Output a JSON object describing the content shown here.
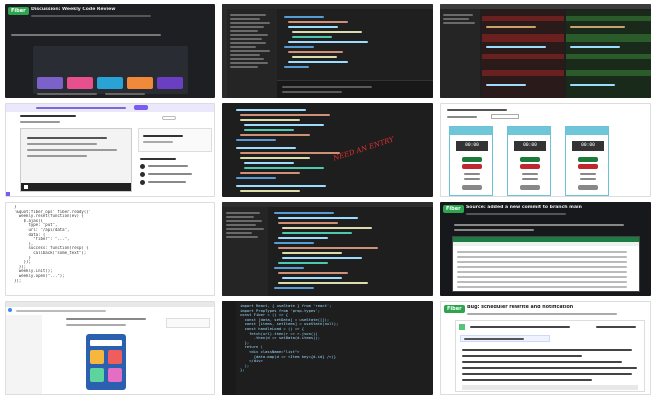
{
  "tiles": {
    "t1": {
      "badge": "Fiber",
      "title": "Discussion: Weekly Code Review",
      "cards": [
        "",
        "",
        "",
        "",
        ""
      ]
    },
    "t5": {
      "banner": "",
      "banner_button": "",
      "page_title": "",
      "sidebar_title": "",
      "sidebar_subtitle": "",
      "list_title": "",
      "follow_label": ""
    },
    "t6": {
      "handwritten": "NEED AN ENTRY"
    },
    "t7": {
      "title": "",
      "filter_label": "",
      "panels": [
        {
          "header": "",
          "value": "00:00"
        },
        {
          "header": "",
          "value": "00:00"
        },
        {
          "header": "",
          "value": "00:00"
        }
      ],
      "start": "",
      "stop": "",
      "reset": ""
    },
    "t8": {
      "code": [
        "}",
        "'&quot;fiber_ops' fiber.ready()'",
        "",
        "",
        "  weekly.reset(function(ev) {",
        "    $.ajax({",
        "      type: \"put\",",
        "      url: \"/api/data\",",
        "      data: {",
        "        \"fiber\": \"...\",",
        "      },",
        "      success: function(resp) {",
        "        callback(\"some_text\");",
        "      }",
        "    });",
        "  });",
        "",
        "  weekly.init();",
        "  weekly.open(\"...\");",
        "});"
      ]
    },
    "t11": {
      "badge": "Fiber",
      "title": "Source: added a new commit to branch main"
    },
    "t14": {
      "code": [
        "import React, { useState } from 'react';",
        "import PropTypes from 'prop-types';",
        "",
        "const Fiber = () => {",
        "  const [data, setData] = useState([]);",
        "  const [items, setItems] = useState(null);",
        "",
        "  const handleLoad = () => {",
        "    fetch(url).then(r => r.json())",
        "      .then(d => setData(d.items));",
        "  };",
        "",
        "  return (",
        "    <div className=\"list\">",
        "      {data.map(d => <Item key={d.id} />)}",
        "    </div>",
        "  );",
        "};"
      ]
    },
    "t15": {
      "badge": "Fiber",
      "title": "Bug: scheduler rewrite and notification",
      "meta": "",
      "comment_head": "",
      "subhead": "",
      "body": [
        "",
        "",
        "",
        "",
        "",
        ""
      ]
    }
  }
}
